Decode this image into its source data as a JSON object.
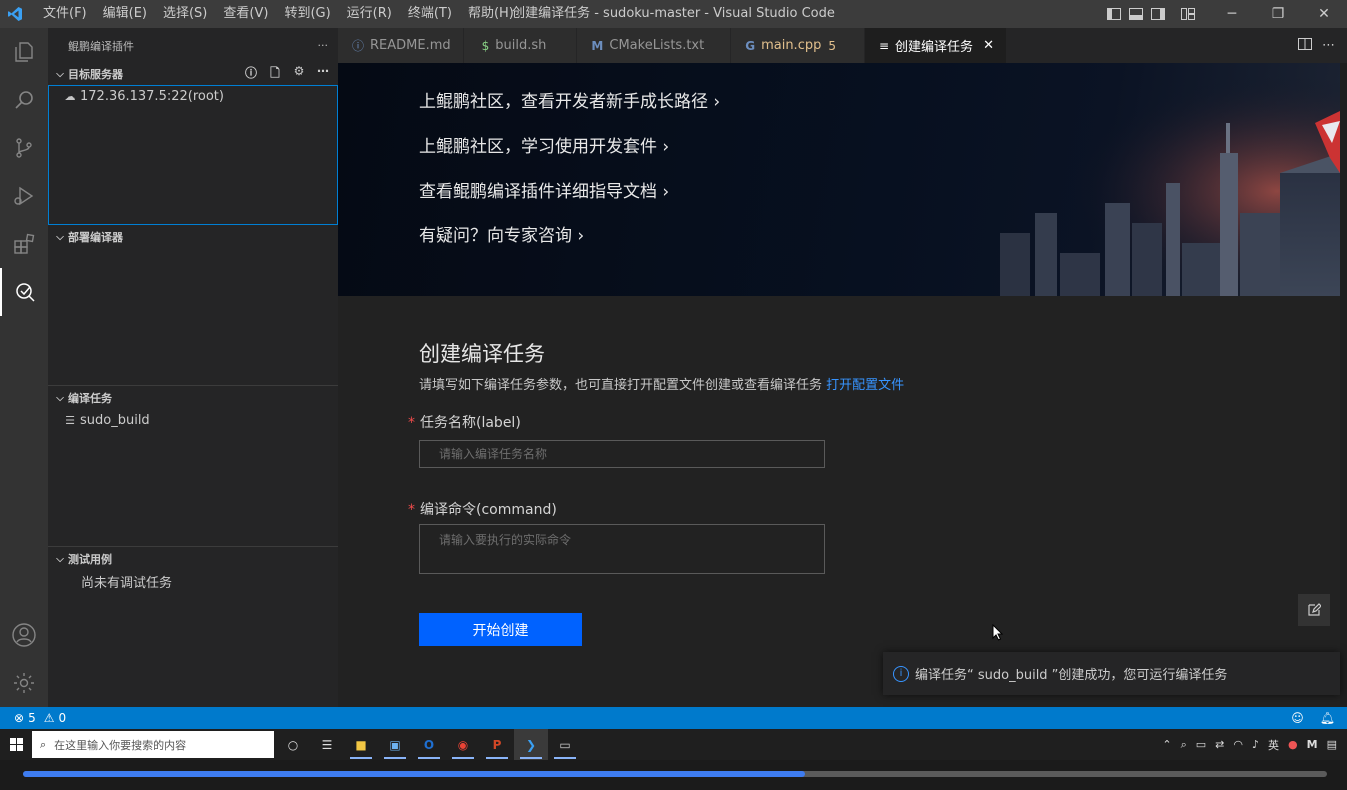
{
  "window": {
    "title": "创建编译任务 - sudoku-master - Visual Studio Code",
    "logo": "vscode-logo",
    "menu": [
      "文件(F)",
      "编辑(E)",
      "选择(S)",
      "查看(V)",
      "转到(G)",
      "运行(R)",
      "终端(T)",
      "帮助(H)"
    ]
  },
  "sidebar": {
    "header": "鲲鹏编译插件",
    "more": "···",
    "sections": {
      "target_servers": {
        "title": "目标服务器",
        "items": [
          "172.36.137.5:22(root)"
        ]
      },
      "deploy_compiler": {
        "title": "部署编译器"
      },
      "compile_tasks": {
        "title": "编译任务",
        "items": [
          "sudo_build"
        ]
      },
      "test_cases": {
        "title": "测试用例",
        "empty_text": "尚未有调试任务"
      }
    }
  },
  "tabs": [
    {
      "label": "README.md",
      "icon": "info-icon",
      "color": "#969696"
    },
    {
      "label": "build.sh",
      "icon": "dollar-icon",
      "color": "#969696"
    },
    {
      "label": "CMakeLists.txt",
      "icon": "cmake-icon",
      "color": "#969696"
    },
    {
      "label": "main.cpp",
      "badge": "5",
      "icon": "cpp-icon",
      "color": "#e2c08d"
    },
    {
      "label": "创建编译任务",
      "icon": "lines-icon",
      "active": true
    }
  ],
  "banner": {
    "links": [
      "上鲲鹏社区，查看开发者新手成长路径",
      "上鲲鹏社区，学习使用开发套件",
      "查看鲲鹏编译插件详细指导文档",
      "有疑问？向专家咨询"
    ]
  },
  "form": {
    "title": "创建编译任务",
    "description": "请填写如下编译任务参数，也可直接打开配置文件创建或查看编译任务",
    "open_config_link": "打开配置文件",
    "required_mark": "*",
    "label_field": {
      "label": "任务名称(label)",
      "placeholder": "请输入编译任务名称",
      "value": ""
    },
    "command_field": {
      "label": "编译命令(command)",
      "placeholder": "请输入要执行的实际命令",
      "value": ""
    },
    "submit": "开始创建"
  },
  "notification": {
    "text": "编译任务“ sudo_build ”创建成功，您可运行编译任务"
  },
  "statusbar": {
    "errors": "5",
    "warnings": "0"
  },
  "taskbar": {
    "search_placeholder": "在这里输入你要搜索的内容",
    "tray_lang": "英"
  },
  "progress": {
    "fraction": 0.6
  }
}
